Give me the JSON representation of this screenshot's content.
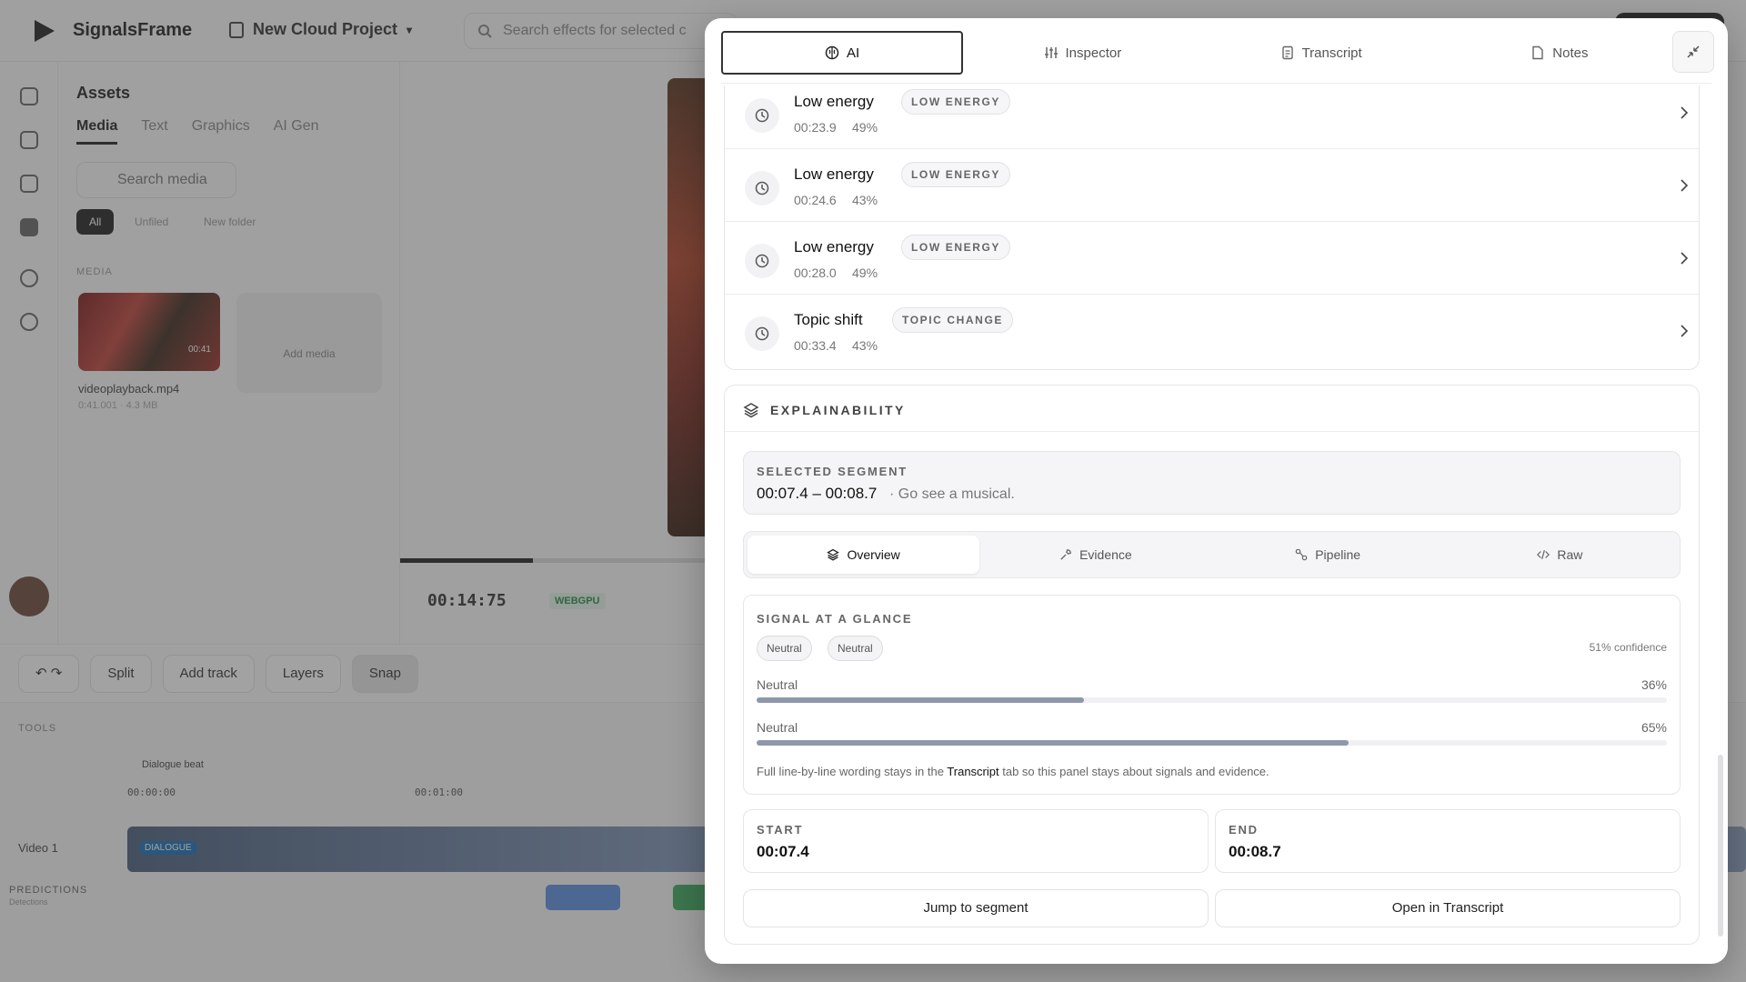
{
  "background": {
    "brand": "SignalsFrame",
    "project": "New Cloud Project",
    "search_placeholder": "Search effects for selected c",
    "assets": {
      "title": "Assets",
      "tabs": [
        "Media",
        "Text",
        "Graphics",
        "AI Gen"
      ],
      "search_placeholder": "Search media",
      "chips": [
        "All",
        "Unfiled",
        "New folder"
      ],
      "section": "MEDIA",
      "file_name": "videoplayback.mp4",
      "file_meta": "0:41.001 · 4.3 MB",
      "add_media": "Add media",
      "thumb_time": "00:41"
    },
    "preview": {
      "timecode": "00:14:75",
      "badge": "WEBGPU",
      "progress": 0.43
    },
    "toolbar": {
      "split": "Split",
      "add_track": "Add track",
      "layers": "Layers",
      "snap": "Snap"
    },
    "timeline": {
      "tools_label": "TOOLS",
      "clip_label": "Dialogue beat",
      "ticks": [
        "00:00:00",
        "00:01:00"
      ],
      "track_name": "Video 1",
      "track_badge": "DIALOGUE",
      "predictions_label": "PREDICTIONS",
      "predictions_sub": "Detections"
    }
  },
  "modal": {
    "tabs": [
      {
        "label": "AI",
        "icon": "brain-icon",
        "active": true
      },
      {
        "label": "Inspector",
        "icon": "sliders-icon",
        "active": false
      },
      {
        "label": "Transcript",
        "icon": "document-icon",
        "active": false
      },
      {
        "label": "Notes",
        "icon": "file-icon",
        "active": false
      }
    ],
    "events": [
      {
        "title": "Low energy",
        "badge": "LOW ENERGY",
        "time": "00:23.9",
        "pct": "49%"
      },
      {
        "title": "Low energy",
        "badge": "LOW ENERGY",
        "time": "00:24.6",
        "pct": "43%"
      },
      {
        "title": "Low energy",
        "badge": "LOW ENERGY",
        "time": "00:28.0",
        "pct": "49%"
      },
      {
        "title": "Topic shift",
        "badge": "TOPIC CHANGE",
        "time": "00:33.4",
        "pct": "43%"
      }
    ],
    "explain": {
      "heading": "EXPLAINABILITY",
      "selected_label": "SELECTED SEGMENT",
      "selected_range": "00:07.4 – 00:08.7",
      "selected_text": "· Go see a musical.",
      "subtabs": [
        {
          "label": "Overview",
          "active": true
        },
        {
          "label": "Evidence",
          "active": false
        },
        {
          "label": "Pipeline",
          "active": false
        },
        {
          "label": "Raw",
          "active": false
        }
      ],
      "glance": {
        "label": "SIGNAL AT A GLANCE",
        "pills": [
          "Neutral",
          "Neutral"
        ],
        "confidence": "51% confidence",
        "bars": [
          {
            "label": "Neutral",
            "pct_text": "36%",
            "value": 0.36
          },
          {
            "label": "Neutral",
            "pct_text": "65%",
            "value": 0.65
          }
        ],
        "note_pre": "Full line-by-line wording stays in the ",
        "note_link": "Transcript",
        "note_post": " tab so this panel stays about signals and evidence."
      },
      "start_label": "START",
      "start_value": "00:07.4",
      "end_label": "END",
      "end_value": "00:08.7",
      "jump_button": "Jump to segment",
      "open_button": "Open in Transcript"
    }
  }
}
